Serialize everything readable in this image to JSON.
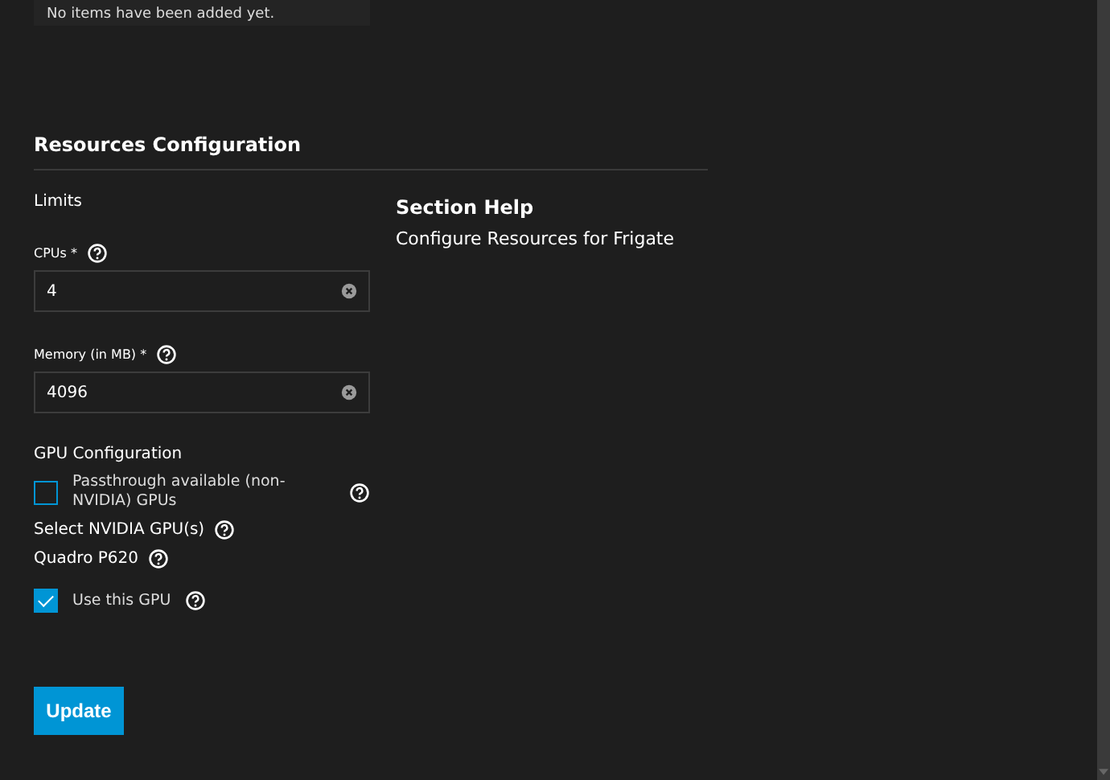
{
  "empty_list": {
    "message": "No items have been added yet."
  },
  "section": {
    "title": "Resources Configuration",
    "limits": {
      "title": "Limits",
      "fields": [
        {
          "label": "CPUs *",
          "value": "4"
        },
        {
          "label": "Memory (in MB) *",
          "value": "4096"
        }
      ]
    },
    "gpu": {
      "title": "GPU Configuration",
      "passthrough": {
        "label": "Passthrough available (non-NVIDIA) GPUs",
        "checked": false
      },
      "select_label": "Select NVIDIA GPU(s)",
      "device": "Quadro P620",
      "use_gpu": {
        "label": "Use this GPU",
        "checked": true
      }
    },
    "help": {
      "title": "Section Help",
      "text": "Configure Resources for Frigate"
    }
  },
  "buttons": [
    {
      "label": "Update"
    }
  ]
}
